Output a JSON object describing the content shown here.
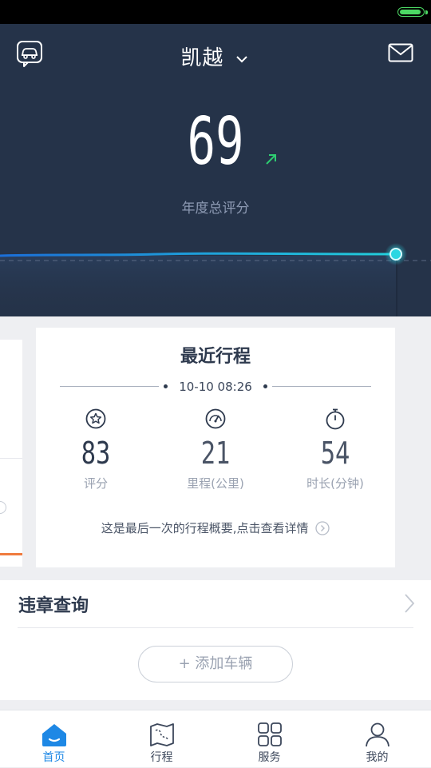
{
  "header": {
    "car_name": "凯越",
    "annual_score": "69",
    "score_label": "年度总评分"
  },
  "recent_trip": {
    "title": "最近行程",
    "datetime": "10-10 08:26",
    "stats": [
      {
        "value": "83",
        "label": "评分",
        "icon": "star-badge-icon"
      },
      {
        "value": "21",
        "label": "里程(公里)",
        "icon": "speedometer-icon"
      },
      {
        "value": "54",
        "label": "时长(分钟)",
        "icon": "stopwatch-icon"
      }
    ],
    "summary_note": "这是最后一次的行程概要,点击查看详情"
  },
  "violation": {
    "title": "违章查询",
    "add_vehicle_label": "+ 添加车辆"
  },
  "tabs": [
    {
      "label": "首页",
      "icon": "home-icon",
      "active": true
    },
    {
      "label": "行程",
      "icon": "map-route-icon",
      "active": false
    },
    {
      "label": "服务",
      "icon": "grid-icon",
      "active": false
    },
    {
      "label": "我的",
      "icon": "person-icon",
      "active": false
    }
  ],
  "colors": {
    "hero_bg": "#253349",
    "accent_blue": "#1e88e5",
    "line_cyan": "#22c7d8",
    "trend_green": "#2ecc71",
    "text_dark": "#2e3a4e",
    "tab_active": "#1e88e5"
  }
}
